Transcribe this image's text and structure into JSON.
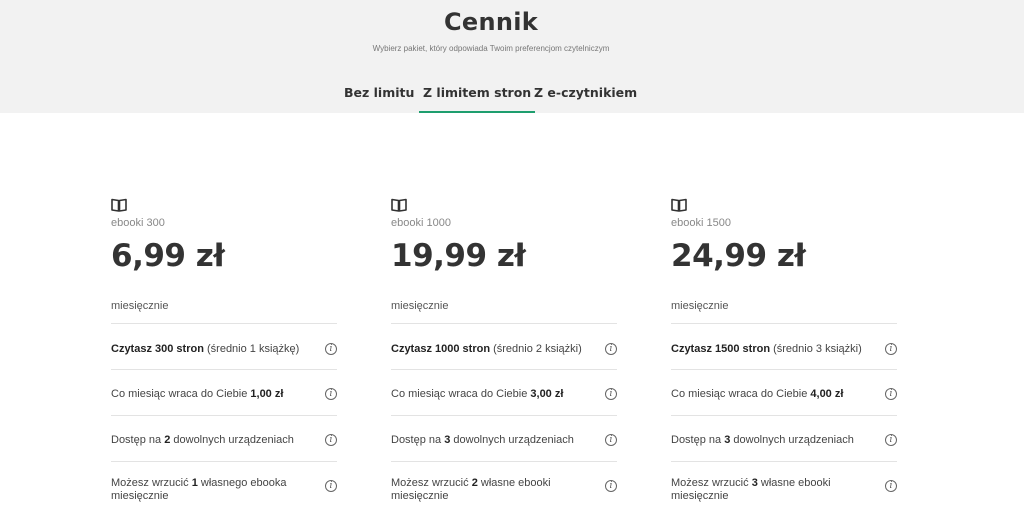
{
  "header": {
    "title": "Cennik",
    "subtitle": "Wybierz pakiet, który odpowiada Twoim preferencjom czytelniczym"
  },
  "tabs": [
    {
      "label": "Bez limitu",
      "active": false
    },
    {
      "label": "Z limitem stron",
      "active": true
    },
    {
      "label": "Z e-czytnikiem",
      "active": false
    }
  ],
  "colors": {
    "accent": "#1e9e6e",
    "header_bg": "#f2f2f2"
  },
  "info_glyph": "i",
  "cards": [
    {
      "icon": "book-icon",
      "name": "ebooki 300",
      "price": "6,99 zł",
      "period": "miesięcznie",
      "features": [
        {
          "bold": "Czytasz 300 stron",
          "rest": " (średnio 1 książkę)"
        },
        {
          "pre": "Co miesiąc wraca do Ciebie ",
          "bold": "1,00 zł"
        },
        {
          "pre": "Dostęp na ",
          "bold": "2",
          "rest": " dowolnych urządzeniach"
        },
        {
          "pre": "Możesz wrzucić ",
          "bold": "1",
          "rest": " własnego ebooka miesięcznie"
        }
      ]
    },
    {
      "icon": "book-icon",
      "name": "ebooki 1000",
      "price": "19,99 zł",
      "period": "miesięcznie",
      "features": [
        {
          "bold": "Czytasz 1000 stron",
          "rest": " (średnio 2 książki)"
        },
        {
          "pre": "Co miesiąc wraca do Ciebie ",
          "bold": "3,00 zł"
        },
        {
          "pre": "Dostęp na ",
          "bold": "3",
          "rest": " dowolnych urządzeniach"
        },
        {
          "pre": "Możesz wrzucić ",
          "bold": "2",
          "rest": " własne ebooki miesięcznie"
        }
      ]
    },
    {
      "icon": "book-icon",
      "name": "ebooki 1500",
      "price": "24,99 zł",
      "period": "miesięcznie",
      "features": [
        {
          "bold": "Czytasz 1500 stron",
          "rest": " (średnio 3 książki)"
        },
        {
          "pre": "Co miesiąc wraca do Ciebie ",
          "bold": "4,00 zł"
        },
        {
          "pre": "Dostęp na ",
          "bold": "3",
          "rest": " dowolnych urządzeniach"
        },
        {
          "pre": "Możesz wrzucić ",
          "bold": "3",
          "rest": " własne ebooki miesięcznie"
        }
      ]
    }
  ]
}
